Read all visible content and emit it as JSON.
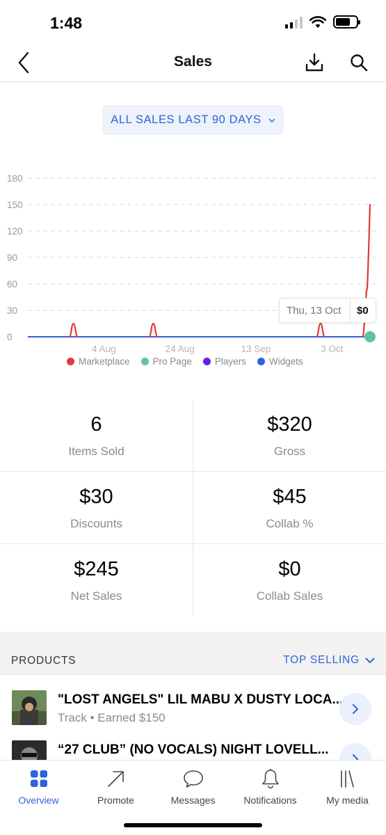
{
  "status_bar": {
    "time": "1:48"
  },
  "header": {
    "title": "Sales",
    "back_icon": "chevron-left-icon",
    "download_icon": "download-icon",
    "search_icon": "search-icon"
  },
  "period": {
    "label": "ALL SALES LAST 90 DAYS",
    "icon": "chevron-down-icon"
  },
  "colors": {
    "accent": "#2f62d8",
    "marketplace": "#e03a33",
    "pro_page": "#5ec3a1",
    "players": "#6a1fe0",
    "widgets": "#2f62d8"
  },
  "chart_data": {
    "type": "line",
    "y_ticks": [
      "180",
      "150",
      "120",
      "90",
      "60",
      "30",
      "0"
    ],
    "ylim": [
      0,
      180
    ],
    "x_tick_labels": [
      "4 Aug",
      "24 Aug",
      "13 Sep",
      "3 Oct"
    ],
    "grid": true,
    "legend_position": "bottom",
    "series": [
      {
        "name": "Marketplace",
        "x": [
          "15 Jul",
          "4 Aug",
          "24 Aug",
          "13 Sep",
          "3 Oct",
          "13 Oct"
        ],
        "spikes": [
          {
            "x": "27 Jul",
            "y": 15
          },
          {
            "x": "17 Aug",
            "y": 15
          },
          {
            "x": "30 Sep",
            "y": 15
          },
          {
            "x": "13 Oct",
            "y": 150
          }
        ]
      },
      {
        "name": "Pro Page",
        "points": [
          {
            "x": "13 Oct",
            "y": 0
          }
        ]
      },
      {
        "name": "Players",
        "points": []
      },
      {
        "name": "Widgets",
        "baseline": 0
      }
    ],
    "tooltip": {
      "date": "Thu, 13 Oct",
      "value": "$0"
    }
  },
  "legend": [
    {
      "label": "Marketplace",
      "color": "#e03a33"
    },
    {
      "label": "Pro Page",
      "color": "#5ec3a1"
    },
    {
      "label": "Players",
      "color": "#6a1fe0"
    },
    {
      "label": "Widgets",
      "color": "#2f62d8"
    }
  ],
  "stats": [
    {
      "value": "6",
      "label": "Items Sold"
    },
    {
      "value": "$320",
      "label": "Gross"
    },
    {
      "value": "$30",
      "label": "Discounts"
    },
    {
      "value": "$45",
      "label": "Collab %"
    },
    {
      "value": "$245",
      "label": "Net Sales"
    },
    {
      "value": "$0",
      "label": "Collab Sales"
    }
  ],
  "products": {
    "title": "PRODUCTS",
    "sort_label": "TOP SELLING",
    "items": [
      {
        "title": "\"LOST ANGELS\" LIL MABU X DUSTY LOCA...",
        "subtitle": "Track • Earned $150"
      },
      {
        "title": "“27 CLUB” (NO VOCALS) NIGHT LOVELL...",
        "subtitle": ""
      }
    ]
  },
  "tabs": [
    {
      "label": "Overview",
      "icon": "grid-icon",
      "active": true
    },
    {
      "label": "Promote",
      "icon": "arrow-up-right-icon",
      "active": false
    },
    {
      "label": "Messages",
      "icon": "chat-bubble-icon",
      "active": false
    },
    {
      "label": "Notifications",
      "icon": "bell-icon",
      "active": false
    },
    {
      "label": "My media",
      "icon": "library-icon",
      "active": false
    }
  ]
}
